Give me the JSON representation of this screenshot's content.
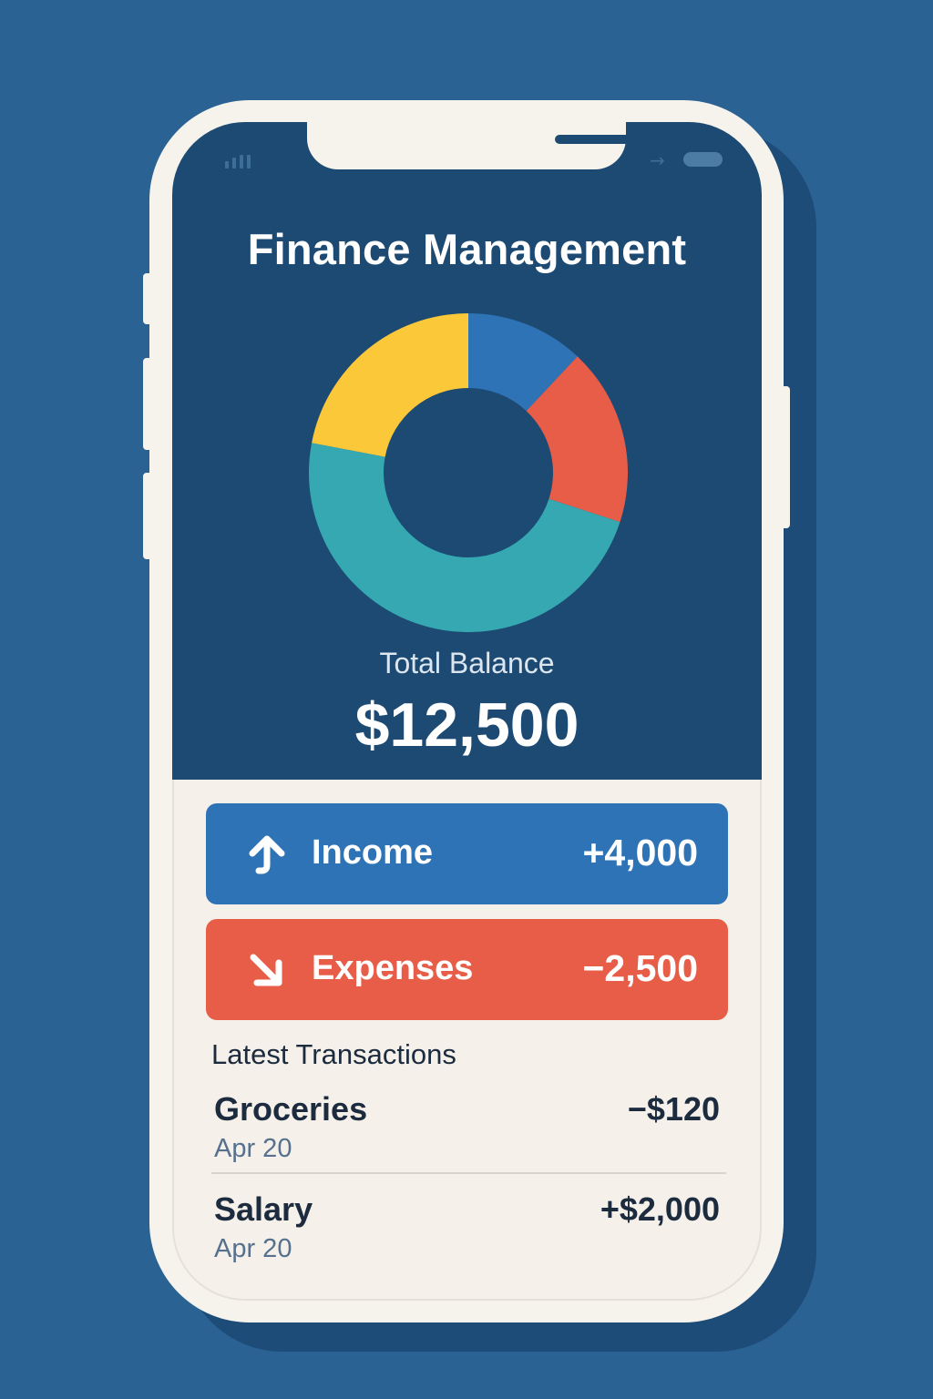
{
  "app": {
    "title": "Finance Management"
  },
  "status_bar": {
    "signal_icon": "signal-icon",
    "connection_icon": "arrow-right-icon",
    "battery_icon": "battery-icon"
  },
  "chart_data": {
    "type": "pie",
    "categories": [
      "",
      "",
      "",
      ""
    ],
    "values": [
      12,
      18,
      48,
      22
    ],
    "colors": [
      "#2E73B5",
      "#E85D48",
      "#35A8B2",
      "#FBC83A"
    ],
    "title": "",
    "style": "donut"
  },
  "balance": {
    "label": "Total Balance",
    "value": "$12,500"
  },
  "summary": {
    "income": {
      "label": "Income",
      "amount": "+4,000",
      "icon": "arrow-up-icon",
      "color": "#2E73B5"
    },
    "expenses": {
      "label": "Expenses",
      "amount": "−2,500",
      "icon": "arrow-down-right-icon",
      "color": "#E85D48"
    }
  },
  "transactions": {
    "title": "Latest Transactions",
    "items": [
      {
        "name": "Groceries",
        "date": "Apr 20",
        "amount": "−$120"
      },
      {
        "name": "Salary",
        "date": "Apr 20",
        "amount": "+$2,000"
      }
    ]
  },
  "colors": {
    "background": "#2B6294",
    "header": "#1D4A73",
    "screen": "#F5F1EA",
    "text_dark": "#1C2B3E",
    "text_muted": "#56708D"
  }
}
